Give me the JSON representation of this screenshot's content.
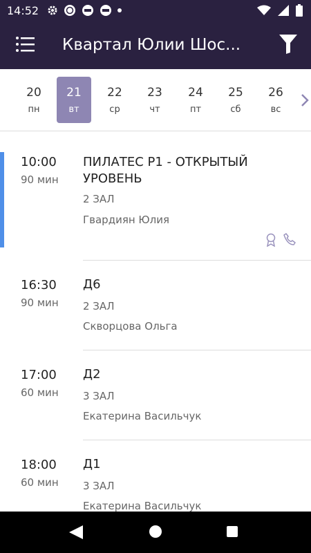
{
  "status_bar": {
    "time": "14:52"
  },
  "app_bar": {
    "title": "Квартал Юлии Шос..."
  },
  "days": [
    {
      "num": "20",
      "dow": "пн",
      "selected": false
    },
    {
      "num": "21",
      "dow": "вт",
      "selected": true
    },
    {
      "num": "22",
      "dow": "ср",
      "selected": false
    },
    {
      "num": "23",
      "dow": "чт",
      "selected": false
    },
    {
      "num": "24",
      "dow": "пт",
      "selected": false
    },
    {
      "num": "25",
      "dow": "сб",
      "selected": false
    },
    {
      "num": "26",
      "dow": "вс",
      "selected": false
    }
  ],
  "sessions": [
    {
      "time": "10:00",
      "duration": "90 мин",
      "name": "ПИЛАТЕС Р1 - ОТКРЫТЫЙ УРОВЕНЬ",
      "room": "2 ЗАЛ",
      "coach": "Гвардиян Юлия",
      "badges": [
        "award-icon",
        "phone-icon"
      ]
    },
    {
      "time": "16:30",
      "duration": "90 мин",
      "name": "Д6",
      "room": "2 ЗАЛ",
      "coach": "Скворцова Ольга"
    },
    {
      "time": "17:00",
      "duration": "60 мин",
      "name": "Д2",
      "room": "3 ЗАЛ",
      "coach": "Екатерина Васильчук"
    },
    {
      "time": "18:00",
      "duration": "60 мин",
      "name": "Д1",
      "room": "3 ЗАЛ",
      "coach": "Екатерина Васильчук"
    }
  ],
  "colors": {
    "header_bg": "#2a2140",
    "selected_day": "#8e86b3",
    "accent": "#4f8fe8"
  }
}
